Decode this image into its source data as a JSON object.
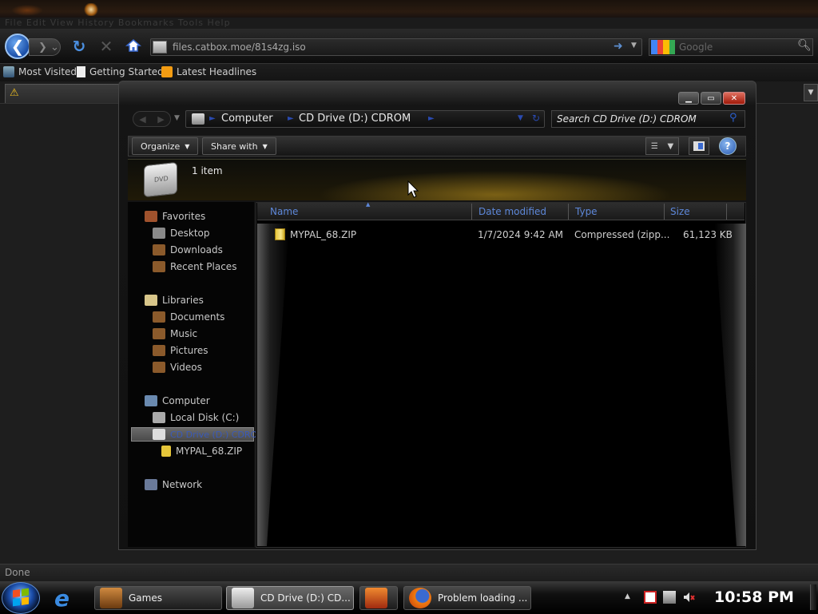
{
  "browser": {
    "menu_text": "File   Edit   View   History   Bookmarks   Tools   Help",
    "url": "files.catbox.moe/81s4zg.iso",
    "search_placeholder": "Google",
    "bookmarks": [
      "Most Visited",
      "Getting Started",
      "Latest Headlines"
    ],
    "status": "Done"
  },
  "explorer": {
    "breadcrumb": [
      "Computer",
      "CD Drive (D:) CDROM"
    ],
    "search_placeholder": "Search CD Drive (D:) CDROM",
    "toolbar": {
      "organize": "Organize",
      "share_with": "Share with"
    },
    "item_count": "1 item",
    "nav": {
      "favorites": "Favorites",
      "desktop": "Desktop",
      "downloads": "Downloads",
      "recent_places": "Recent Places",
      "libraries": "Libraries",
      "documents": "Documents",
      "music": "Music",
      "pictures": "Pictures",
      "videos": "Videos",
      "computer": "Computer",
      "local_disk": "Local Disk (C:)",
      "cd_drive": "CD Drive (D:) CDROM",
      "zip_child": "MYPAL_68.ZIP",
      "network": "Network"
    },
    "columns": {
      "name": "Name",
      "date": "Date modified",
      "type": "Type",
      "size": "Size"
    },
    "files": [
      {
        "name": "MYPAL_68.ZIP",
        "date": "1/7/2024 9:42 AM",
        "type": "Compressed (zipp...",
        "size": "61,123 KB"
      }
    ]
  },
  "taskbar": {
    "tasks": [
      "Games",
      "CD Drive (D:) CD...",
      "Problem loading ..."
    ],
    "clock": "10:58 PM"
  },
  "colors": {
    "accent_blue": "#5d87d8",
    "close_red": "#c0281a"
  }
}
